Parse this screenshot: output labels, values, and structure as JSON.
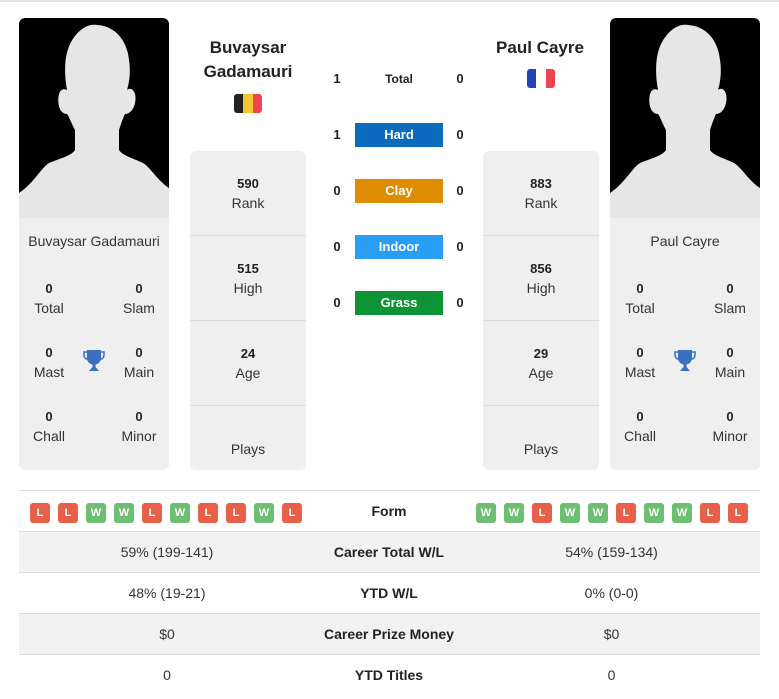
{
  "colors": {
    "hard": "#0b6bbd",
    "clay": "#de8c00",
    "indoor": "#2a9df4",
    "grass": "#0f9337",
    "win": "#6fbf73",
    "loss": "#e8604a",
    "trophy": "#3b6fbf"
  },
  "player1": {
    "name_line1": "Buvaysar",
    "name_line2": "Gadamauri",
    "full_name": "Buvaysar Gadamauri",
    "flag": {
      "country": "Belgium",
      "colors": [
        "#222222",
        "#f7c531",
        "#f0444f"
      ]
    },
    "titles": {
      "total": {
        "value": "0",
        "label": "Total"
      },
      "slam": {
        "value": "0",
        "label": "Slam"
      },
      "mast": {
        "value": "0",
        "label": "Mast"
      },
      "main": {
        "value": "0",
        "label": "Main"
      },
      "chall": {
        "value": "0",
        "label": "Chall"
      },
      "minor": {
        "value": "0",
        "label": "Minor"
      }
    },
    "stats": {
      "rank": {
        "value": "590",
        "label": "Rank"
      },
      "high": {
        "value": "515",
        "label": "High"
      },
      "age": {
        "value": "24",
        "label": "Age"
      },
      "plays": {
        "value": "",
        "label": "Plays"
      }
    },
    "form": [
      "L",
      "L",
      "W",
      "W",
      "L",
      "W",
      "L",
      "L",
      "W",
      "L"
    ]
  },
  "player2": {
    "name_line1": "Paul Cayre",
    "full_name": "Paul Cayre",
    "flag": {
      "country": "France",
      "colors": [
        "#2442b8",
        "#ffffff",
        "#f0444f"
      ]
    },
    "titles": {
      "total": {
        "value": "0",
        "label": "Total"
      },
      "slam": {
        "value": "0",
        "label": "Slam"
      },
      "mast": {
        "value": "0",
        "label": "Mast"
      },
      "main": {
        "value": "0",
        "label": "Main"
      },
      "chall": {
        "value": "0",
        "label": "Chall"
      },
      "minor": {
        "value": "0",
        "label": "Minor"
      }
    },
    "stats": {
      "rank": {
        "value": "883",
        "label": "Rank"
      },
      "high": {
        "value": "856",
        "label": "High"
      },
      "age": {
        "value": "29",
        "label": "Age"
      },
      "plays": {
        "value": "",
        "label": "Plays"
      }
    },
    "form": [
      "W",
      "W",
      "L",
      "W",
      "W",
      "L",
      "W",
      "W",
      "L",
      "L"
    ]
  },
  "h2h": [
    {
      "key": "total",
      "label": "Total",
      "p1": "1",
      "p2": "0"
    },
    {
      "key": "hard",
      "label": "Hard",
      "p1": "1",
      "p2": "0"
    },
    {
      "key": "clay",
      "label": "Clay",
      "p1": "0",
      "p2": "0"
    },
    {
      "key": "indoor",
      "label": "Indoor",
      "p1": "0",
      "p2": "0"
    },
    {
      "key": "grass",
      "label": "Grass",
      "p1": "0",
      "p2": "0"
    }
  ],
  "table": {
    "form_label": "Form",
    "rows": [
      {
        "label": "Career Total W/L",
        "p1": "59% (199-141)",
        "p2": "54% (159-134)"
      },
      {
        "label": "YTD W/L",
        "p1": "48% (19-21)",
        "p2": "0% (0-0)"
      },
      {
        "label": "Career Prize Money",
        "p1": "$0",
        "p2": "$0"
      },
      {
        "label": "YTD Titles",
        "p1": "0",
        "p2": "0"
      }
    ]
  }
}
